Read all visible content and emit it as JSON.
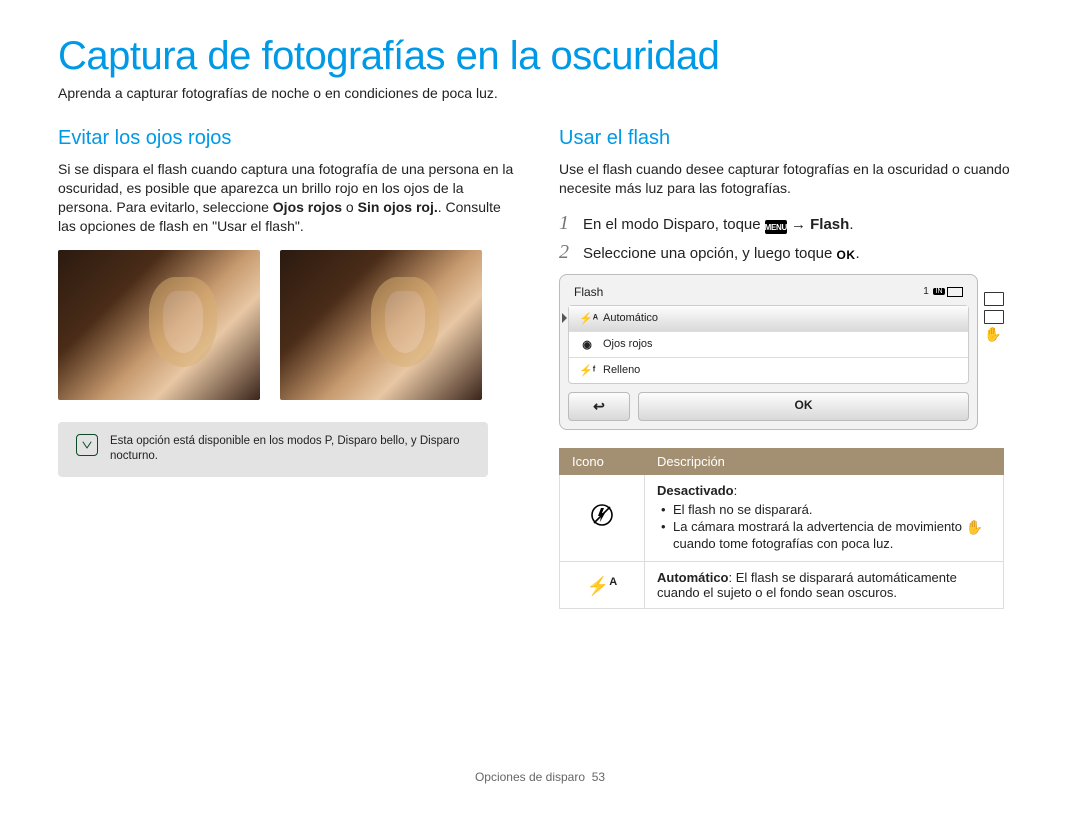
{
  "page": {
    "title": "Captura de fotografías en la oscuridad",
    "subtitle": "Aprenda a capturar fotografías de noche o en condiciones de poca luz.",
    "footer_section": "Opciones de disparo",
    "footer_page": "53"
  },
  "left": {
    "heading": "Evitar los ojos rojos",
    "para_part1": "Si se dispara el flash cuando captura una fotografía de una persona en la oscuridad, es posible que aparezca un brillo rojo en los ojos de la persona. Para evitarlo, seleccione ",
    "para_bold1": "Ojos rojos",
    "para_mid": " o ",
    "para_bold2": "Sin ojos roj.",
    "para_part2": ". Consulte las opciones de flash en \"Usar el flash\".",
    "note": "Esta opción está disponible en los modos P, Disparo bello, y Disparo nocturno."
  },
  "right": {
    "heading": "Usar el flash",
    "para": "Use el flash cuando desee capturar fotografías en la oscuridad o cuando necesite más luz para las fotografías.",
    "step1_num": "1",
    "step1_a": "En el modo Disparo, toque ",
    "step1_menu": "MENU",
    "step1_b": " → ",
    "step1_bold": "Flash",
    "step1_c": ".",
    "step2_num": "2",
    "step2_a": "Seleccione una opción, y luego toque ",
    "step2_ok": "OK",
    "step2_b": ".",
    "lcd": {
      "title": "Flash",
      "count": "1",
      "in": "IN",
      "opt_auto_glyph": "⚡ᴬ",
      "opt_auto": "Automático",
      "opt_red_glyph": "◉",
      "opt_red": "Ojos rojos",
      "opt_fill_glyph": "⚡ᶠ",
      "opt_fill": "Relleno",
      "back": "↩",
      "ok": "OK"
    },
    "table": {
      "h_icon": "Icono",
      "h_desc": "Descripción",
      "r1_title": "Desactivado",
      "r1_colon": ":",
      "r1_b1": "El flash no se disparará.",
      "r1_b2a": "La cámara mostrará la advertencia de movimiento ",
      "r1_b2b": " cuando tome fotografías con poca luz.",
      "r2_bold": "Automático",
      "r2_rest": ": El flash se disparará automáticamente cuando el sujeto o el fondo sean oscuros."
    }
  }
}
